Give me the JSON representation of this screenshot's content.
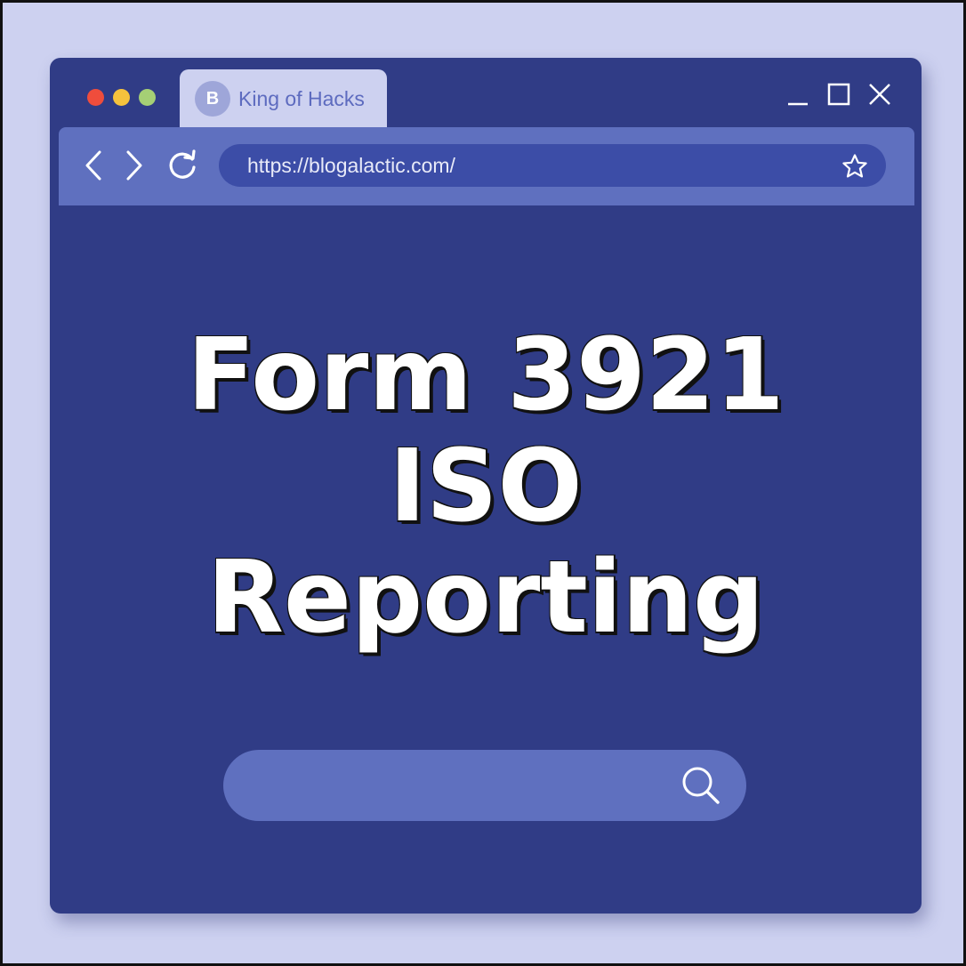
{
  "tab": {
    "badge": "B",
    "title": "King of Hacks"
  },
  "address_bar": {
    "url": "https://blogalactic.com/"
  },
  "headline": {
    "line1": "Form 3921",
    "line2": "ISO",
    "line3": "Reporting"
  },
  "search": {
    "value": ""
  },
  "icons": {
    "window_dots": [
      "close-dot",
      "minimize-dot",
      "maximize-dot"
    ],
    "controls": [
      "minimize-icon",
      "maximize-icon",
      "close-icon"
    ],
    "nav": [
      "back-arrow-icon",
      "forward-arrow-icon",
      "reload-icon"
    ],
    "bookmark": "star-icon",
    "search": "search-icon"
  },
  "colors": {
    "page_background": "#cdd1f0",
    "window": "#303c86",
    "toolbar": "#5f70bf",
    "address_bar": "#3c4da7",
    "dot_red": "#ef4d3c",
    "dot_yellow": "#f5c23d",
    "dot_green": "#a5cf75"
  }
}
